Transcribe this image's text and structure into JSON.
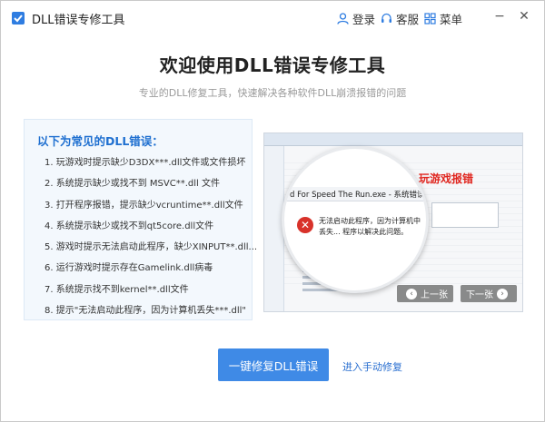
{
  "titlebar": {
    "app_title": "DLL错误专修工具",
    "login": "登录",
    "service": "客服",
    "menu": "菜单",
    "minimize": "−",
    "close": "✕"
  },
  "main": {
    "title": "欢迎使用DLL错误专修工具",
    "subtitle": "专业的DLL修复工具，快速解决各种软件DLL崩溃报错的问题"
  },
  "errors_panel": {
    "heading": "以下为常见的DLL错误：",
    "items": [
      "1. 玩游戏时提示缺少D3DX***.dll文件或文件损坏",
      "2. 系统提示缺少或找不到 MSVC**.dll 文件",
      "3. 打开程序报错，提示缺少vcruntime**.dll文件",
      "4. 系统提示缺少或找不到qt5core.dll文件",
      "5. 游戏时提示无法启动此程序，缺少XINPUT**.dll...",
      "6. 运行游戏时提示存在Gamelink.dll病毒",
      "7. 系统提示找不到kernel**.dll文件",
      "8. 提示\"无法启动此程序，因为计算机丢失***.dll\""
    ]
  },
  "preview": {
    "label": "玩游戏报错",
    "window_title": "d For Speed The Run.exe - 系统错误",
    "message": "无法启动此程序，因为计算机中丢失... 程序以解决此问题。",
    "prev": "上一张",
    "next": "下一张"
  },
  "actions": {
    "fix_button": "一键修复DLL错误",
    "manual_link": "进入手动修复"
  },
  "colors": {
    "accent": "#3f8ae6",
    "heading_blue": "#1e6fd0",
    "error_red": "#e0261f"
  }
}
